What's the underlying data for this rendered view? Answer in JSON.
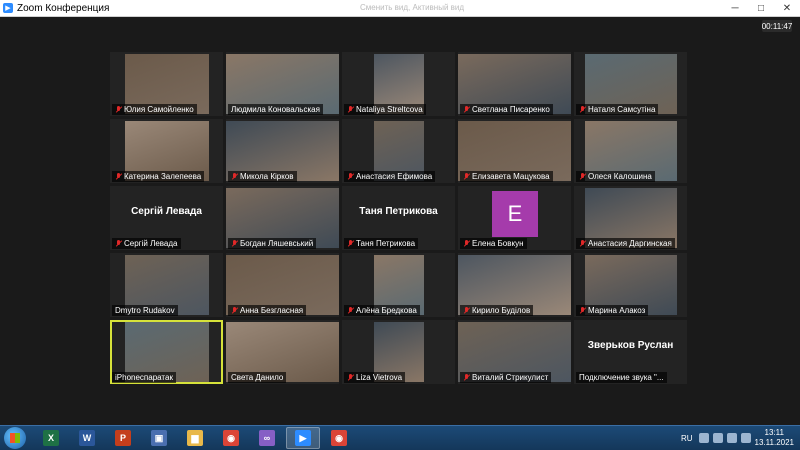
{
  "window": {
    "title": "Zoom Конференция",
    "hint": "Сменить вид, Активный вид"
  },
  "meeting": {
    "timer": "00:11:47"
  },
  "participants": [
    {
      "name": "Юлия Самойленко",
      "muted": true
    },
    {
      "name": "Людмила Коновальская",
      "muted": false
    },
    {
      "name": "Nataliya Streltcova",
      "muted": true
    },
    {
      "name": "Светлана Писаренко",
      "muted": true
    },
    {
      "name": "Наталя Самсутіна",
      "muted": true
    },
    {
      "name": "Катерина Залепеева",
      "muted": true
    },
    {
      "name": "Микола Кірков",
      "muted": true
    },
    {
      "name": "Анастасия Ефимова",
      "muted": true
    },
    {
      "name": "Елизавета Мацукова",
      "muted": true
    },
    {
      "name": "Олеся Калошина",
      "muted": true
    },
    {
      "name": "Сергій Левада",
      "muted": true,
      "display": "Сергій Левада"
    },
    {
      "name": "Богдан Ляшевський",
      "muted": true
    },
    {
      "name": "Таня Петрикова",
      "muted": true,
      "display": "Таня Петрикова"
    },
    {
      "name": "Елена Бовкун",
      "muted": true,
      "avatar_letter": "E"
    },
    {
      "name": "Анастасия Даргинская",
      "muted": true
    },
    {
      "name": "Dmytro Rudakov",
      "muted": false
    },
    {
      "name": "Анна Безгласная",
      "muted": true
    },
    {
      "name": "Алёна Бредкова",
      "muted": true
    },
    {
      "name": "Кирило Буділов",
      "muted": true
    },
    {
      "name": "Марина Алакоз",
      "muted": true
    },
    {
      "name": "iPhonecпаратак",
      "muted": false,
      "active": true
    },
    {
      "name": "Света Данило",
      "muted": false
    },
    {
      "name": "Liza Vietrova",
      "muted": true
    },
    {
      "name": "Виталий Стрикулист",
      "muted": true
    },
    {
      "name": "Подключение звука \"...",
      "muted": false,
      "display": "Зверьков Руслан"
    }
  ],
  "taskbar": {
    "items": [
      {
        "name": "excel-icon",
        "glyph": "X",
        "color": "#1e7145"
      },
      {
        "name": "word-icon",
        "glyph": "W",
        "color": "#2b579a"
      },
      {
        "name": "powerpoint-icon",
        "glyph": "P",
        "color": "#c43e1c"
      },
      {
        "name": "save-app-icon",
        "glyph": "▣",
        "color": "#4a6fb0"
      },
      {
        "name": "folder-icon",
        "glyph": "▆",
        "color": "#e8b84a"
      },
      {
        "name": "chrome-icon",
        "glyph": "◉",
        "color": "#db4437"
      },
      {
        "name": "visual-studio-icon",
        "glyph": "∞",
        "color": "#865fc5"
      },
      {
        "name": "zoom-icon",
        "glyph": "▶",
        "color": "#2d8cff"
      },
      {
        "name": "chrome-icon-2",
        "glyph": "◉",
        "color": "#db4437"
      }
    ],
    "lang": "RU",
    "time": "13:11",
    "date": "13.11.2021"
  }
}
